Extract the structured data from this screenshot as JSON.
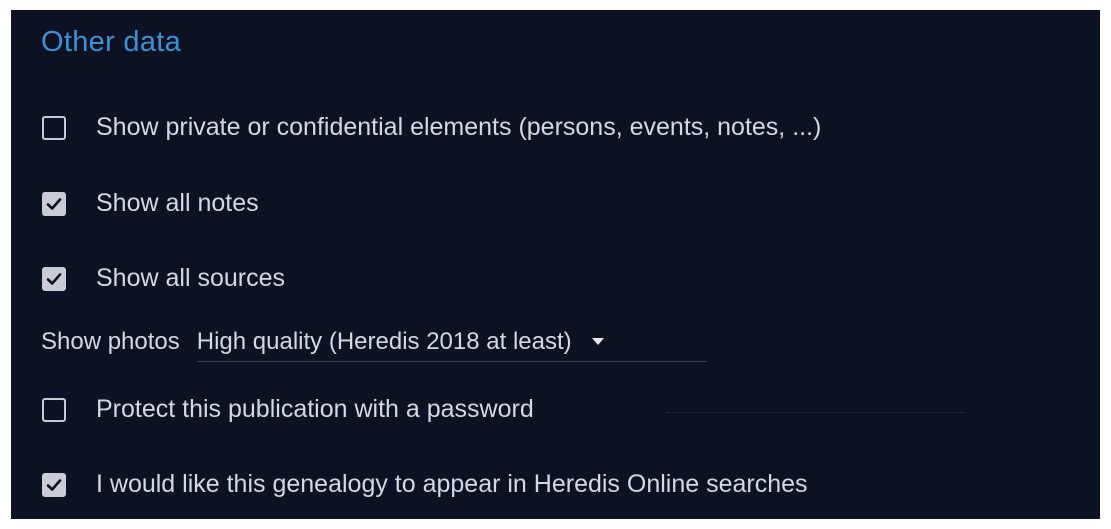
{
  "section": {
    "title": "Other data"
  },
  "options": [
    {
      "label": "Show private or confidential elements (persons, events, notes, ...)",
      "checked": false
    },
    {
      "label": "Show all notes",
      "checked": true
    },
    {
      "label": "Show all sources",
      "checked": true
    }
  ],
  "photos": {
    "label": "Show photos",
    "selected": "High quality (Heredis 2018 at least)"
  },
  "password_option": {
    "label": "Protect this publication with a password",
    "checked": false,
    "value": ""
  },
  "search_option": {
    "label": "I would like this genealogy to appear in Heredis Online searches",
    "checked": true
  },
  "colors": {
    "background": "#0c1224",
    "accent": "#3f8fd4",
    "text": "#d4d8e0"
  }
}
